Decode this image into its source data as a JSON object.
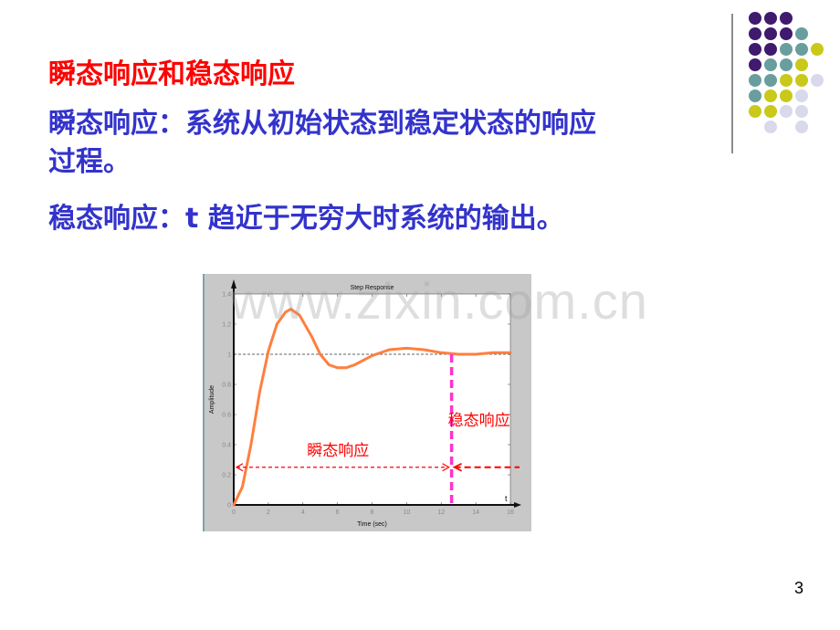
{
  "slide": {
    "title": "瞬态响应和稳态响应",
    "lines": [
      "瞬态响应：系统从初始状态到稳定状态的响应",
      "过程。",
      "稳态响应：t 趋近于无穷大时系统的输出。"
    ],
    "page_number": "3",
    "colors": {
      "title": "#ff0000",
      "body": "#3333cc",
      "curve": "#ff7f3f",
      "divider": "#ff33cc",
      "annotation": "#ff0000"
    }
  },
  "decoration": {
    "dot_rows": [
      [
        "purple",
        "purple",
        "purple"
      ],
      [
        "purple",
        "purple",
        "purple",
        "teal"
      ],
      [
        "purple",
        "purple",
        "teal",
        "teal",
        "yellow"
      ],
      [
        "purple",
        "teal",
        "teal",
        "yellow"
      ],
      [
        "teal",
        "teal",
        "yellow",
        "yellow",
        "lavender"
      ],
      [
        "teal",
        "yellow",
        "yellow",
        "lavender"
      ],
      [
        "yellow",
        "yellow",
        "lavender",
        "lavender"
      ],
      [
        "",
        "lavender",
        "",
        "lavender"
      ]
    ],
    "palette": {
      "purple": "#3f1a6e",
      "teal": "#6a9e9e",
      "yellow": "#c9c91a",
      "lavender": "#d9d9ec"
    }
  },
  "watermark": "www.zixin.com.cn",
  "chart_data": {
    "type": "line",
    "title": "Step Response",
    "xlabel": "Time (sec)",
    "ylabel": "Amplitude",
    "xlim": [
      0,
      16
    ],
    "ylim": [
      0,
      1.4
    ],
    "xticks": [
      "0",
      "2",
      "4",
      "6",
      "8",
      "10",
      "12",
      "14",
      "16"
    ],
    "yticks": [
      "0",
      "0.2",
      "0.4",
      "0.6",
      "0.8",
      "1",
      "1.2",
      "1.4"
    ],
    "x_axis_arrow_label": "t",
    "steady_state_reference": 1,
    "series": [
      {
        "name": "step response",
        "x": [
          0,
          0.5,
          1,
          1.5,
          2,
          2.5,
          3,
          3.3,
          3.8,
          4.5,
          5,
          5.5,
          6,
          6.5,
          7,
          8,
          9,
          10,
          11,
          12,
          13,
          14,
          15,
          16
        ],
        "y": [
          0,
          0.12,
          0.4,
          0.75,
          1.02,
          1.2,
          1.28,
          1.3,
          1.26,
          1.12,
          1.0,
          0.93,
          0.91,
          0.91,
          0.93,
          0.99,
          1.03,
          1.04,
          1.03,
          1.01,
          1.0,
          1.0,
          1.01,
          1.01
        ]
      }
    ],
    "annotations": {
      "divider_time": 12.6,
      "arrow_level": 0.25,
      "transient_label": "瞬态响应",
      "steady_label": "稳态响应"
    }
  }
}
